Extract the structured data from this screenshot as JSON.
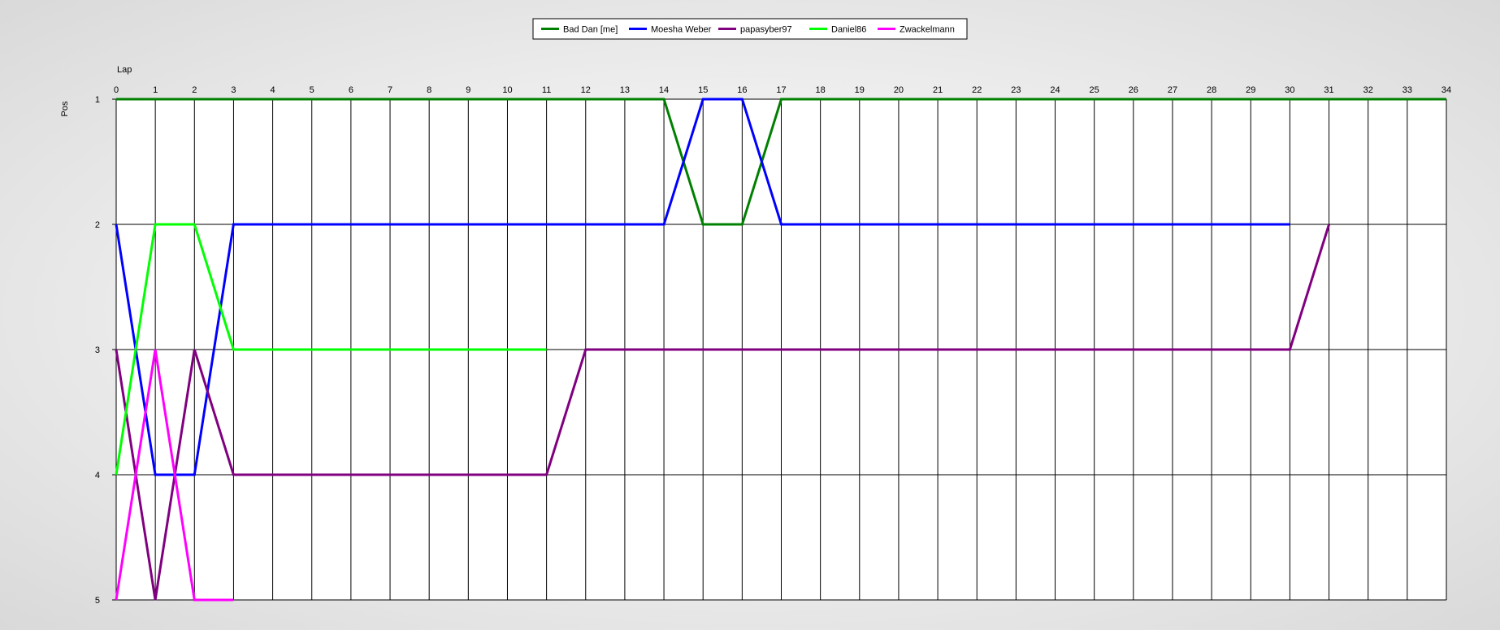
{
  "chart_data": {
    "type": "line",
    "xlabel": "Lap",
    "ylabel": "Pos",
    "xlim": [
      0,
      34
    ],
    "ylim": [
      1,
      5
    ],
    "y_inverted": true,
    "grid": true,
    "legend_position": "top-center",
    "x_ticks": [
      0,
      1,
      2,
      3,
      4,
      5,
      6,
      7,
      8,
      9,
      10,
      11,
      12,
      13,
      14,
      15,
      16,
      17,
      18,
      19,
      20,
      21,
      22,
      23,
      24,
      25,
      26,
      27,
      28,
      29,
      30,
      31,
      32,
      33,
      34
    ],
    "y_ticks": [
      1,
      2,
      3,
      4,
      5
    ],
    "series": [
      {
        "name": "Bad Dan [me]",
        "color": "#008000",
        "points": [
          [
            0,
            1
          ],
          [
            1,
            1
          ],
          [
            2,
            1
          ],
          [
            3,
            1
          ],
          [
            4,
            1
          ],
          [
            5,
            1
          ],
          [
            6,
            1
          ],
          [
            7,
            1
          ],
          [
            8,
            1
          ],
          [
            9,
            1
          ],
          [
            10,
            1
          ],
          [
            11,
            1
          ],
          [
            12,
            1
          ],
          [
            13,
            1
          ],
          [
            14,
            1
          ],
          [
            15,
            2
          ],
          [
            16,
            2
          ],
          [
            17,
            1
          ],
          [
            18,
            1
          ],
          [
            19,
            1
          ],
          [
            20,
            1
          ],
          [
            21,
            1
          ],
          [
            22,
            1
          ],
          [
            23,
            1
          ],
          [
            24,
            1
          ],
          [
            25,
            1
          ],
          [
            26,
            1
          ],
          [
            27,
            1
          ],
          [
            28,
            1
          ],
          [
            29,
            1
          ],
          [
            30,
            1
          ],
          [
            31,
            1
          ],
          [
            32,
            1
          ],
          [
            33,
            1
          ],
          [
            34,
            1
          ]
        ]
      },
      {
        "name": "Moesha Weber",
        "color": "#0000FF",
        "points": [
          [
            0,
            2
          ],
          [
            1,
            4
          ],
          [
            2,
            4
          ],
          [
            3,
            2
          ],
          [
            4,
            2
          ],
          [
            5,
            2
          ],
          [
            6,
            2
          ],
          [
            7,
            2
          ],
          [
            8,
            2
          ],
          [
            9,
            2
          ],
          [
            10,
            2
          ],
          [
            11,
            2
          ],
          [
            12,
            2
          ],
          [
            13,
            2
          ],
          [
            14,
            2
          ],
          [
            15,
            1
          ],
          [
            16,
            1
          ],
          [
            17,
            2
          ],
          [
            18,
            2
          ],
          [
            19,
            2
          ],
          [
            20,
            2
          ],
          [
            21,
            2
          ],
          [
            22,
            2
          ],
          [
            23,
            2
          ],
          [
            24,
            2
          ],
          [
            25,
            2
          ],
          [
            26,
            2
          ],
          [
            27,
            2
          ],
          [
            28,
            2
          ],
          [
            29,
            2
          ],
          [
            30,
            2
          ]
        ]
      },
      {
        "name": "papasyber97",
        "color": "#800080",
        "points": [
          [
            0,
            3
          ],
          [
            1,
            5
          ],
          [
            2,
            3
          ],
          [
            3,
            4
          ],
          [
            4,
            4
          ],
          [
            5,
            4
          ],
          [
            6,
            4
          ],
          [
            7,
            4
          ],
          [
            8,
            4
          ],
          [
            9,
            4
          ],
          [
            10,
            4
          ],
          [
            11,
            4
          ],
          [
            12,
            3
          ],
          [
            13,
            3
          ],
          [
            14,
            3
          ],
          [
            15,
            3
          ],
          [
            16,
            3
          ],
          [
            17,
            3
          ],
          [
            18,
            3
          ],
          [
            19,
            3
          ],
          [
            20,
            3
          ],
          [
            21,
            3
          ],
          [
            22,
            3
          ],
          [
            23,
            3
          ],
          [
            24,
            3
          ],
          [
            25,
            3
          ],
          [
            26,
            3
          ],
          [
            27,
            3
          ],
          [
            28,
            3
          ],
          [
            29,
            3
          ],
          [
            30,
            3
          ],
          [
            31,
            2
          ]
        ]
      },
      {
        "name": "Daniel86",
        "color": "#00FF00",
        "points": [
          [
            0,
            4
          ],
          [
            1,
            2
          ],
          [
            2,
            2
          ],
          [
            3,
            3
          ],
          [
            4,
            3
          ],
          [
            5,
            3
          ],
          [
            6,
            3
          ],
          [
            7,
            3
          ],
          [
            8,
            3
          ],
          [
            9,
            3
          ],
          [
            10,
            3
          ],
          [
            11,
            3
          ]
        ]
      },
      {
        "name": "Zwackelmann",
        "color": "#FF00FF",
        "points": [
          [
            0,
            5
          ],
          [
            1,
            3
          ],
          [
            2,
            5
          ],
          [
            3,
            5
          ]
        ]
      }
    ]
  }
}
